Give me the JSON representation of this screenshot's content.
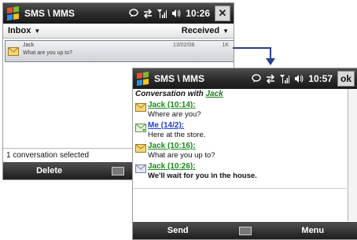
{
  "colors": {
    "sender_green": "#1a8a1a",
    "me_blue": "#1d3fd0",
    "titlebar": "#2a2a2a",
    "pointer": "#2a3d8f"
  },
  "screen1": {
    "title": "SMS \\ MMS",
    "time": "10:26",
    "close_label": "✕",
    "folder": "Inbox",
    "sort": "Received",
    "message": {
      "sender": "Jack",
      "preview": "What are you up to?",
      "date": "13/02/08",
      "size": "1K"
    },
    "status": "1 conversation selected",
    "softkey_left": "Delete",
    "softkey_right": ""
  },
  "screen2": {
    "title": "SMS \\ MMS",
    "time": "10:57",
    "ok_label": "ok",
    "conversation_label": "Conversation with",
    "conversation_name": "Jack",
    "messages": [
      {
        "from": "Jack (10:14):",
        "body": "Where are you?",
        "type": "received"
      },
      {
        "from": "Me (14/2):",
        "body": "Here at the store.",
        "type": "sent"
      },
      {
        "from": "Jack (10:16):",
        "body": "What are you up to?",
        "type": "received"
      },
      {
        "from": "Jack (10:26):",
        "body": "We'll wait for you in the house.",
        "type": "new"
      }
    ],
    "softkey_left": "Send",
    "softkey_right": "Menu"
  },
  "icons": [
    "windows-flag-icon",
    "notification-icon",
    "sync-icon",
    "signal-icon",
    "volume-icon",
    "envelope-icon",
    "keyboard-icon"
  ]
}
